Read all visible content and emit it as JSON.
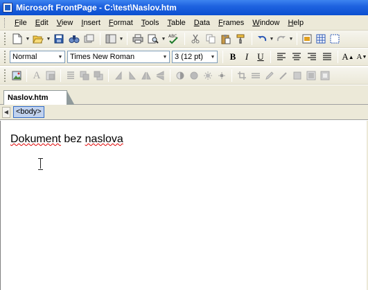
{
  "window": {
    "title": "Microsoft FrontPage - C:\\test\\Naslov.htm"
  },
  "menubar": {
    "items": [
      "File",
      "Edit",
      "View",
      "Insert",
      "Format",
      "Tools",
      "Table",
      "Data",
      "Frames",
      "Window",
      "Help"
    ]
  },
  "formatting": {
    "style_value": "Normal",
    "font_value": "Times New Roman",
    "size_value": "3  (12 pt)",
    "bold_label": "B",
    "italic_label": "I",
    "underline_label": "U",
    "grow_font_label": "A",
    "shrink_font_label": "A"
  },
  "document_tabs": {
    "active": "Naslov.htm"
  },
  "quick_tag": {
    "tag": "<body>"
  },
  "editor": {
    "heading_part1": "Dokument",
    "heading_part2": " bez ",
    "heading_part3": "naslova"
  },
  "icons": {
    "standard_toolbar": [
      "new-page-icon",
      "open-icon",
      "save-icon",
      "search-icon",
      "publish-icon",
      "toggle-pane-icon",
      "print-icon",
      "preview-icon",
      "spelling-icon",
      "cut-icon",
      "copy-icon",
      "paste-icon",
      "format-painter-icon",
      "undo-icon",
      "redo-icon",
      "web-component-icon",
      "insert-table-icon",
      "insert-layer-icon"
    ],
    "pictures_toolbar": [
      "insert-picture-icon",
      "text-icon",
      "auto-thumbnail-icon",
      "position-absolute-icon",
      "bring-forward-icon",
      "send-backward-icon",
      "rotate-left-icon",
      "rotate-right-icon",
      "flip-horizontal-icon",
      "flip-vertical-icon",
      "more-contrast-icon",
      "less-contrast-icon",
      "more-brightness-icon",
      "less-brightness-icon",
      "crop-icon",
      "line-style-icon",
      "format-picture-icon",
      "set-transparent-color-icon",
      "color-icon",
      "bevel-icon",
      "resample-icon"
    ]
  },
  "colors": {
    "title_bar": "#0a4fd0",
    "chrome": "#ece9d8",
    "quick_tag_highlight": "#c1d2ee",
    "spelling_underline": "#e00000"
  }
}
